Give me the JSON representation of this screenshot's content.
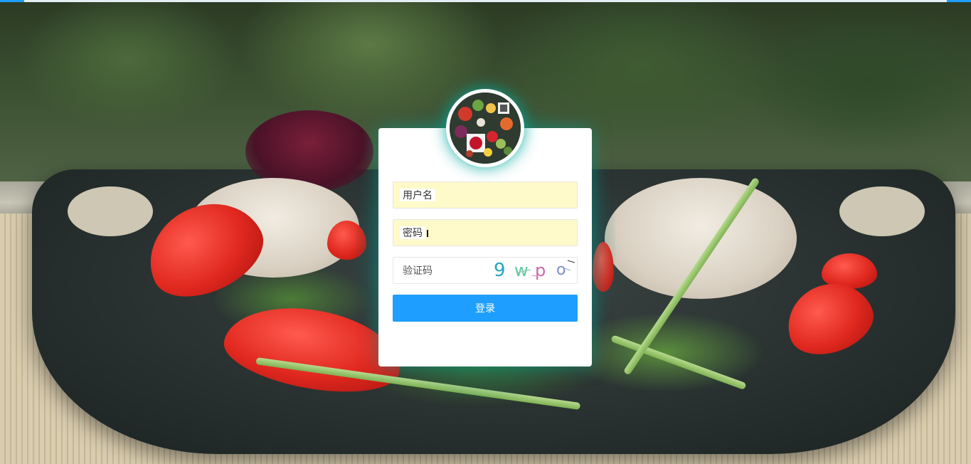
{
  "form": {
    "username_placeholder": "用户名",
    "password_placeholder": "密码",
    "captcha_placeholder": "验证码",
    "captcha_chars": [
      "9",
      "w",
      "p",
      "o"
    ],
    "login_label": "登录"
  },
  "theme": {
    "primary": "#1e9fff",
    "autofill_bg": "#fefac9",
    "glow": "#00a99d"
  },
  "icons": {
    "avatar": "food-logo-image"
  }
}
